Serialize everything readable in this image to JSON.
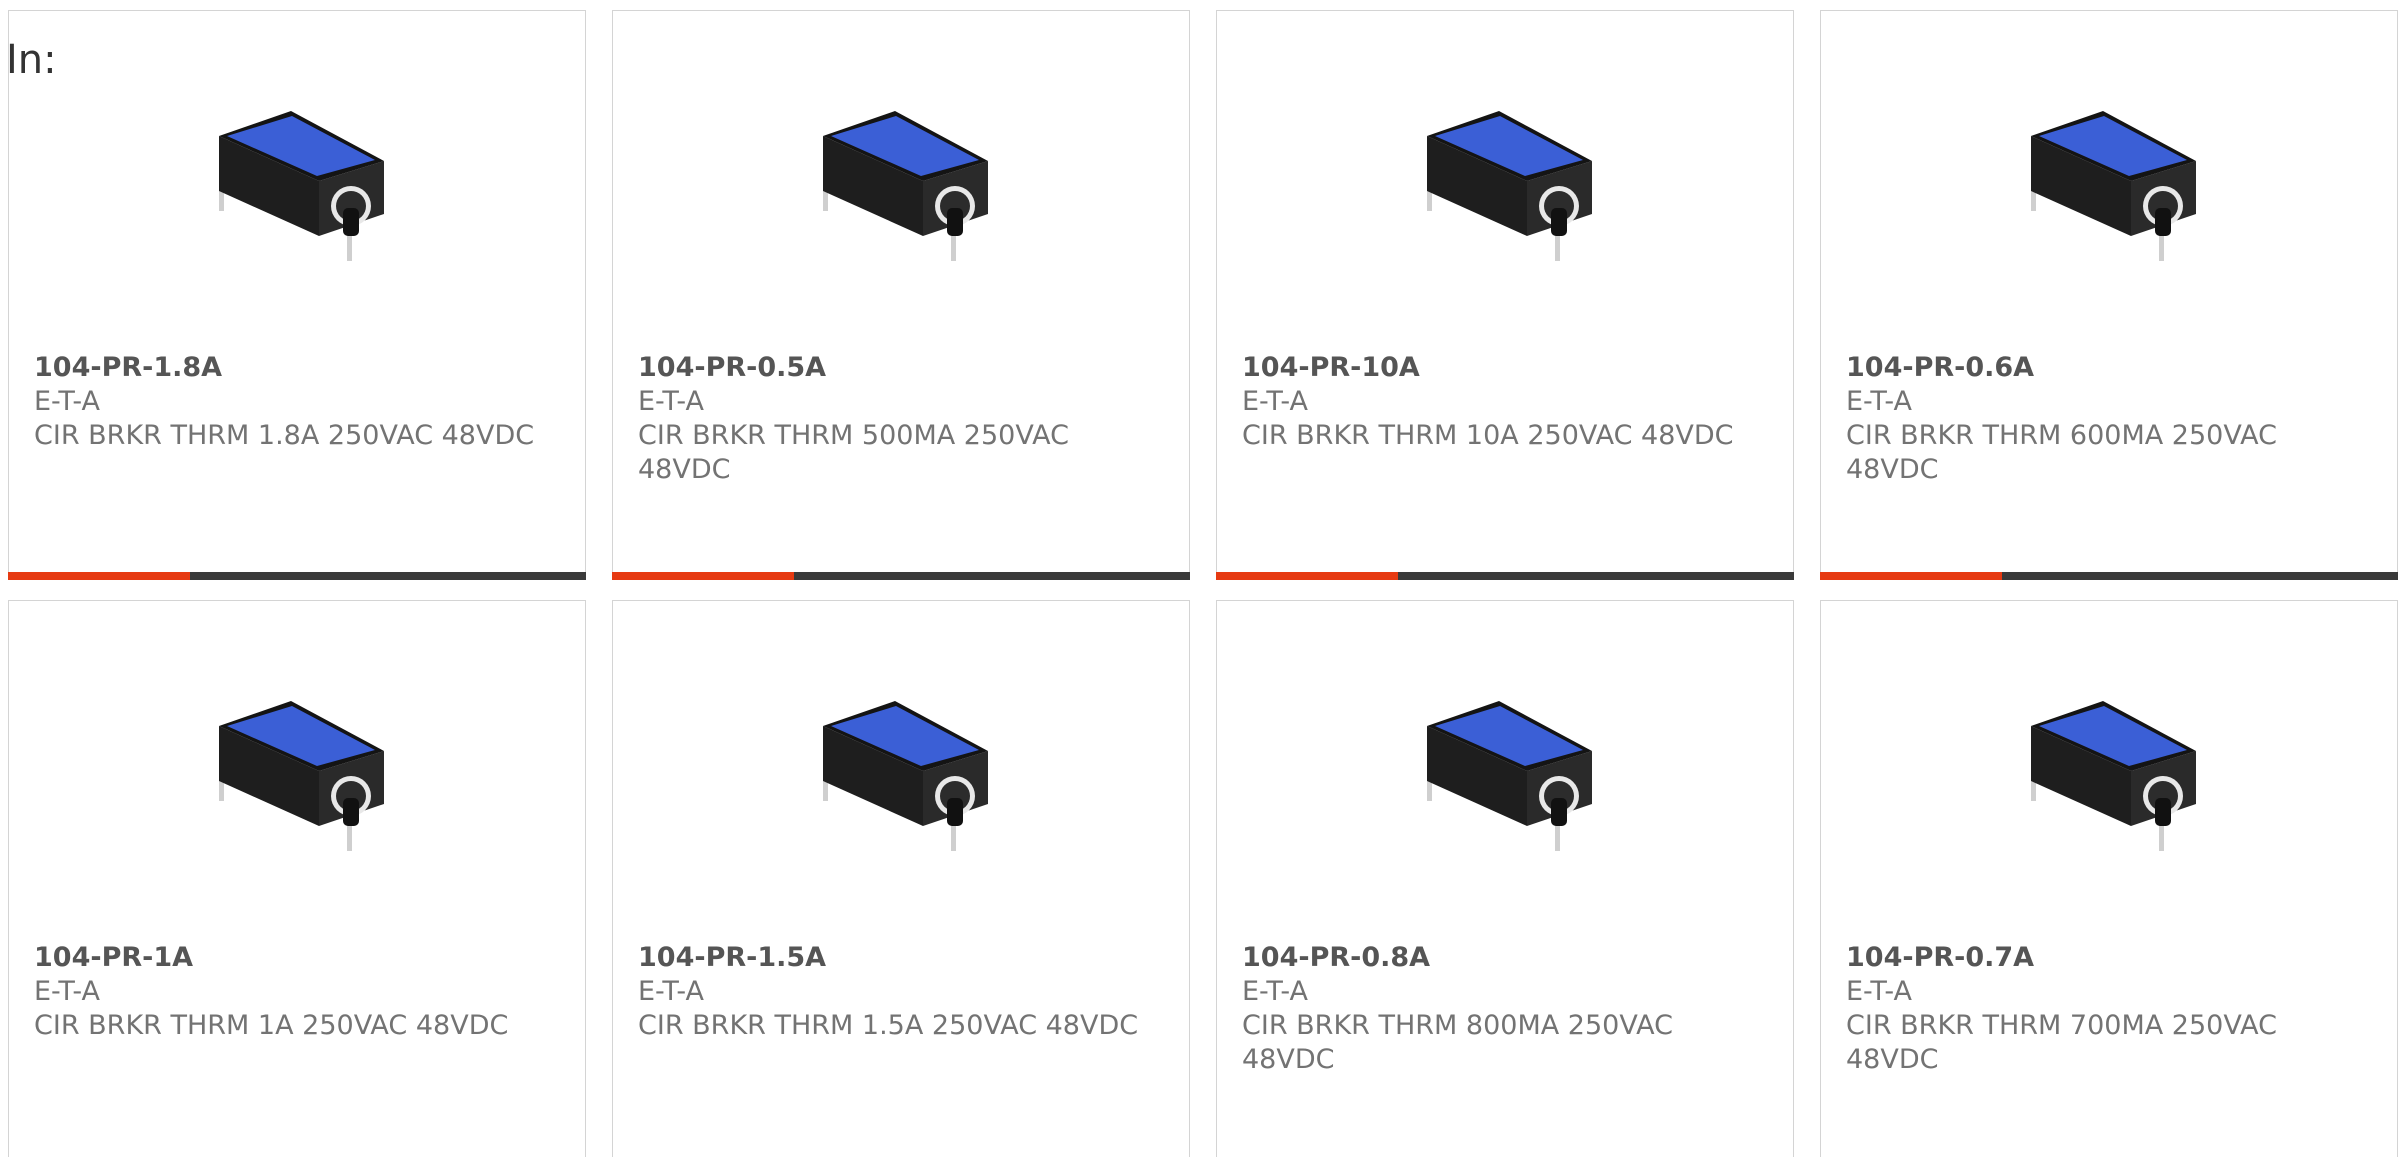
{
  "header": {
    "label": "In:"
  },
  "colors": {
    "accent": "#e63a12",
    "bar": "#3a3a3a",
    "product_top": "#3b5fd6",
    "product_body": "#1e1e1e"
  },
  "products": [
    {
      "part_number": "104-PR-1.8A",
      "manufacturer": "E-T-A",
      "description": "CIR BRKR THRM 1.8A 250VAC 48VDC",
      "image": "circuit-breaker-image"
    },
    {
      "part_number": "104-PR-0.5A",
      "manufacturer": "E-T-A",
      "description": "CIR BRKR THRM 500MA 250VAC 48VDC",
      "image": "circuit-breaker-image"
    },
    {
      "part_number": "104-PR-10A",
      "manufacturer": "E-T-A",
      "description": "CIR BRKR THRM 10A 250VAC 48VDC",
      "image": "circuit-breaker-image"
    },
    {
      "part_number": "104-PR-0.6A",
      "manufacturer": "E-T-A",
      "description": "CIR BRKR THRM 600MA 250VAC 48VDC",
      "image": "circuit-breaker-image"
    },
    {
      "part_number": "104-PR-1A",
      "manufacturer": "E-T-A",
      "description": "CIR BRKR THRM 1A 250VAC 48VDC",
      "image": "circuit-breaker-image"
    },
    {
      "part_number": "104-PR-1.5A",
      "manufacturer": "E-T-A",
      "description": "CIR BRKR THRM 1.5A 250VAC 48VDC",
      "image": "circuit-breaker-image"
    },
    {
      "part_number": "104-PR-0.8A",
      "manufacturer": "E-T-A",
      "description": "CIR BRKR THRM 800MA 250VAC 48VDC",
      "image": "circuit-breaker-image"
    },
    {
      "part_number": "104-PR-0.7A",
      "manufacturer": "E-T-A",
      "description": "CIR BRKR THRM 700MA 250VAC 48VDC",
      "image": "circuit-breaker-image"
    }
  ]
}
